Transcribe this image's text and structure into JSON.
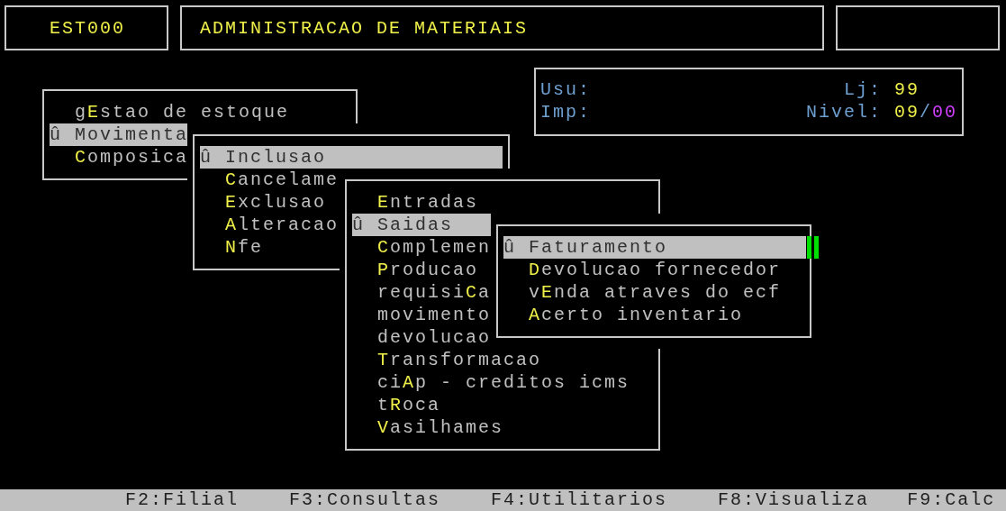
{
  "header": {
    "program_code": "EST000",
    "title": "ADMINISTRACAO DE MATERIAIS"
  },
  "info_panel": {
    "rows": [
      {
        "label": "Usu:",
        "right_label": "Lj:",
        "value_parts": [
          {
            "text": "99",
            "color": "#f0f04a"
          }
        ]
      },
      {
        "label": "Imp:",
        "right_label": "Nivel:",
        "value_parts": [
          {
            "text": "09",
            "color": "#f0f04a"
          },
          {
            "text": "/",
            "color": "#6f9fd0"
          },
          {
            "text": "00",
            "color": "#d040ff"
          }
        ]
      }
    ]
  },
  "menus": [
    {
      "marker": "û",
      "items": [
        {
          "before": "g",
          "key": "E",
          "after": "stao de estoque",
          "selected": false
        },
        {
          "key": "M",
          "after": "ovimenta",
          "selected": true
        },
        {
          "key": "C",
          "after": "omposica",
          "selected": false
        }
      ]
    },
    {
      "marker": "û",
      "items": [
        {
          "key": "I",
          "after": "nclusao",
          "selected": true
        },
        {
          "key": "C",
          "after": "ancelame",
          "selected": false
        },
        {
          "key": "E",
          "after": "xclusao",
          "selected": false
        },
        {
          "key": "A",
          "after": "lteracao",
          "selected": false
        },
        {
          "key": "N",
          "after": "fe",
          "selected": false
        }
      ]
    },
    {
      "marker": "û",
      "items": [
        {
          "key": "E",
          "after": "ntradas",
          "selected": false
        },
        {
          "key": "S",
          "after": "aidas",
          "selected": true
        },
        {
          "key": "C",
          "after": "omplemen",
          "selected": false
        },
        {
          "key": "P",
          "after": "roducao",
          "selected": false
        },
        {
          "before": "requisi",
          "key": "C",
          "after": "a",
          "selected": false
        },
        {
          "before": "movimento",
          "selected": false
        },
        {
          "before": "devolucao",
          "selected": false
        },
        {
          "key": "T",
          "after": "ransformacao",
          "selected": false
        },
        {
          "before": "ci",
          "key": "A",
          "after": "p - creditos icms",
          "selected": false
        },
        {
          "before": "t",
          "key": "R",
          "after": "oca",
          "selected": false
        },
        {
          "key": "V",
          "after": "asilhames",
          "selected": false
        }
      ]
    },
    {
      "marker": "û",
      "cursor": true,
      "items": [
        {
          "key": "F",
          "after": "aturamento",
          "selected": true
        },
        {
          "key": "D",
          "after": "evolucao fornecedor",
          "selected": false
        },
        {
          "before": "v",
          "key": "E",
          "after": "nda atraves do ecf",
          "selected": false
        },
        {
          "key": "A",
          "after": "certo inventario",
          "selected": false
        }
      ]
    }
  ],
  "function_keys": [
    "F2:Filial",
    "F3:Consultas",
    "F4:Utilitarios",
    "F8:Visualiza",
    "F9:Calc"
  ]
}
